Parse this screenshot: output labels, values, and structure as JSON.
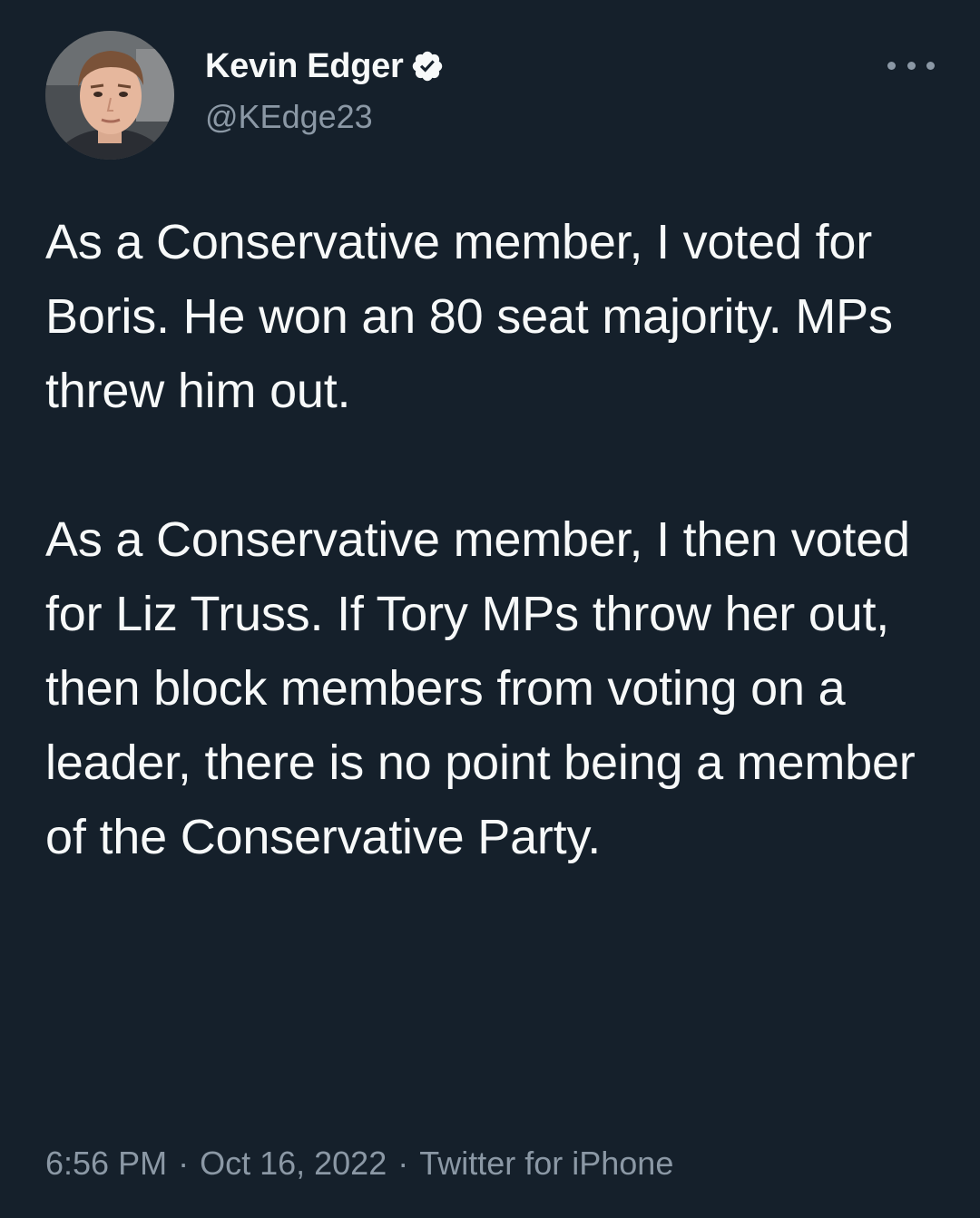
{
  "author": {
    "display_name": "Kevin Edger",
    "handle": "@KEdge23",
    "verified": true,
    "verified_color": "#f7f9f9"
  },
  "menu": {
    "icon": "more-horizontal-icon"
  },
  "tweet": {
    "paragraph_1": "As a Conservative member, I voted for Boris. He won an 80 seat majority. MPs threw him out.",
    "paragraph_2": "As a Conservative member, I then voted for Liz Truss. If Tory MPs throw her out, then block members from voting on a leader, there is no point being a member of the Conservative Party."
  },
  "meta": {
    "time": "6:56 PM",
    "separator": "·",
    "date": "Oct 16, 2022",
    "source": "Twitter for iPhone"
  },
  "colors": {
    "background": "#15202b",
    "text": "#f7f9f9",
    "secondary_text": "#8b98a5"
  }
}
